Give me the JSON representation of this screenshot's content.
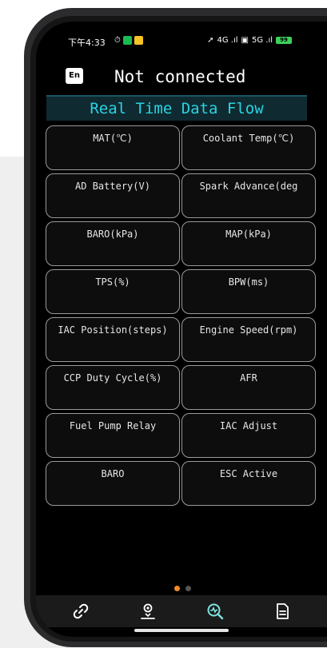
{
  "status_bar": {
    "time": "下午4:33",
    "signal_text": "4G .ıl",
    "signal2_text": "5G .ıl",
    "battery": "99"
  },
  "header": {
    "translate_icon": "En",
    "connection_status": "Not connected"
  },
  "section_title": "Real Time Data Flow",
  "data_cells": [
    "MAT(℃)",
    "Coolant Temp(℃)",
    "AD Battery(V)",
    "Spark Advance(deg",
    "BARO(kPa)",
    "MAP(kPa)",
    "TPS(%)",
    "BPW(ms)",
    "IAC Position(steps)",
    "Engine Speed(rpm)",
    "CCP Duty Cycle(%)",
    "AFR",
    "Fuel Pump Relay",
    "IAC Adjust",
    "BARO",
    "ESC Active"
  ],
  "pager": {
    "pages": 2,
    "active": 0
  },
  "bottom_nav": [
    "link-icon",
    "location-pin-icon",
    "data-search-icon",
    "document-icon"
  ],
  "colors": {
    "accent": "#2ad4e4",
    "title_bg": "#0f2a30",
    "pager_active": "#f28c28",
    "cell_border": "#9a9a9a"
  }
}
